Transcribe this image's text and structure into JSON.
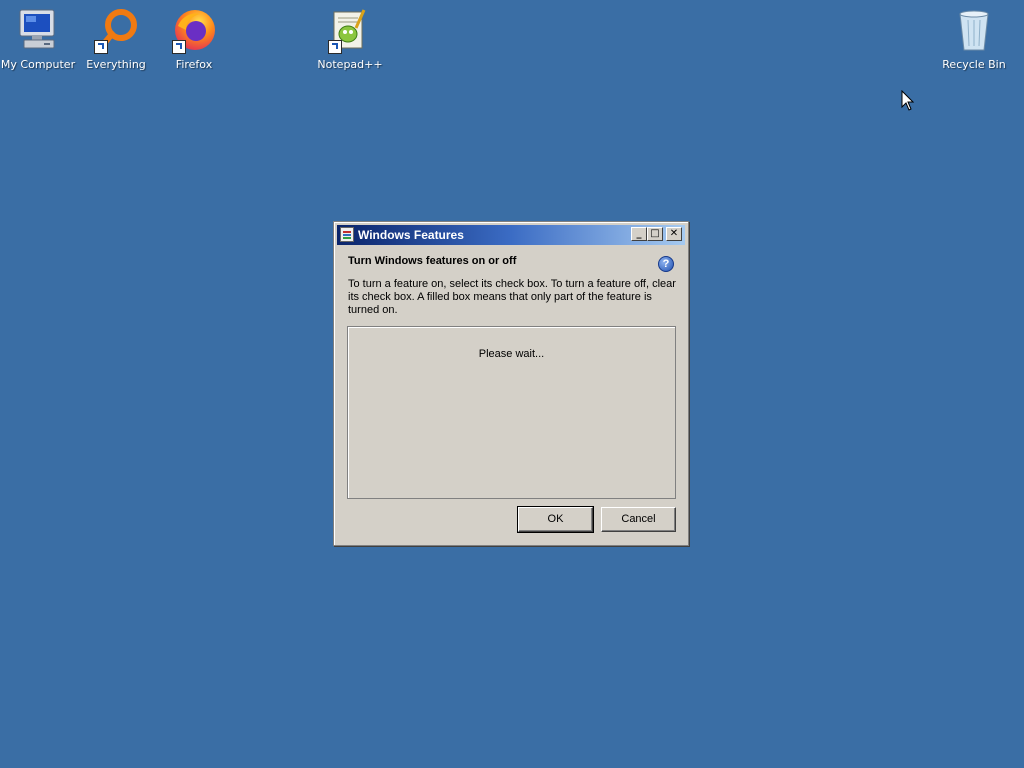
{
  "desktop": {
    "background_color": "#3a6ea5",
    "icons": [
      {
        "label": "My Computer",
        "icon": "my-computer-icon"
      },
      {
        "label": "Everything",
        "icon": "everything-search-icon"
      },
      {
        "label": "Firefox",
        "icon": "firefox-icon"
      },
      {
        "label": "Notepad++",
        "icon": "notepadpp-icon"
      },
      {
        "label": "Recycle Bin",
        "icon": "recycle-bin-icon"
      }
    ]
  },
  "dialog": {
    "title": "Windows Features",
    "heading": "Turn Windows features on or off",
    "description": "To turn a feature on, select its check box. To turn a feature off, clear its check box. A filled box means that only part of the feature is turned on.",
    "status_text": "Please wait...",
    "help_glyph": "?",
    "buttons": {
      "ok": "OK",
      "cancel": "Cancel"
    },
    "titlebar_controls": {
      "minimize": "_",
      "maximize": "□",
      "close": "✕"
    }
  }
}
